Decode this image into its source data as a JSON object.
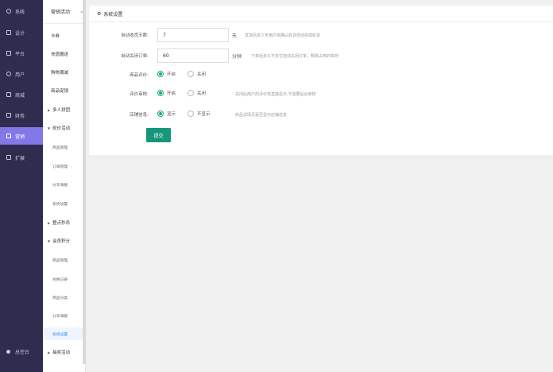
{
  "nav": {
    "items": [
      {
        "label": "系统",
        "icon": "gear-icon"
      },
      {
        "label": "设计",
        "icon": "design-icon"
      },
      {
        "label": "平台",
        "icon": "platform-icon"
      },
      {
        "label": "用户",
        "icon": "user-icon"
      },
      {
        "label": "商城",
        "icon": "shop-icon"
      },
      {
        "label": "财务",
        "icon": "finance-icon"
      },
      {
        "label": "营销",
        "icon": "marketing-icon"
      },
      {
        "label": "扩展",
        "icon": "extend-icon"
      }
    ],
    "bottom": {
      "label": "总控台",
      "icon": "console-icon"
    }
  },
  "submenu": {
    "title": "营销活动",
    "items": [
      "卡券",
      "充值赠送",
      "购物满减",
      "商品促销"
    ],
    "group_pintuan": "多人拼团",
    "group_kanjia": "砍价活动",
    "kanjia_children": [
      "商品管理",
      "订单管理",
      "分享海报",
      "系统设置"
    ],
    "group_miaosha": "整点秒杀",
    "group_jifen": "会员积分",
    "jifen_children": [
      "商品管理",
      "兑换记录",
      "商品分类",
      "分享海报",
      "系统设置"
    ],
    "group_choujiang": "抽奖活动"
  },
  "panel": {
    "title": "系统设置",
    "auto_receive": {
      "label": "自动收货天数:",
      "value": "7",
      "unit": "天",
      "hint": "发货后多少天用户未确认收货自动完成收货"
    },
    "auto_close": {
      "label": "自动关闭订单:",
      "value": "60",
      "unit": "分钟",
      "hint": "下单后多久不支付自动关闭订单，释放占用的库存"
    },
    "goods_comment": {
      "label": "商品评价:",
      "on": "开启",
      "off": "关闭"
    },
    "comment_audit": {
      "label": "评价审核:",
      "on": "开启",
      "off": "关闭",
      "hint": "关闭后用户的评价将直接显示,不需要后台审核"
    },
    "shop_info": {
      "label": "店铺信息:",
      "on": "显示",
      "off": "不显示",
      "hint": "商品详情页是否显示店铺信息"
    },
    "submit_label": "提交"
  },
  "colors": {
    "nav_bg": "#2e2d4f",
    "nav_active": "#8378e8",
    "accent": "#17967a",
    "link": "#2d8cf0"
  }
}
